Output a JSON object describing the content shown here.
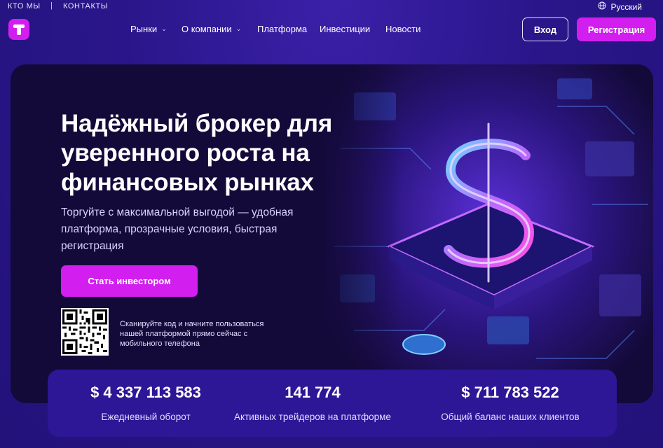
{
  "topbar": {
    "about": "КТО МЫ",
    "separator": "|",
    "contacts": "КОНТАКТЫ",
    "language": "Русский",
    "language_icon": "globe-icon"
  },
  "header": {
    "logo_icon": "t-logo-icon",
    "nav": [
      {
        "label": "Рынки",
        "dropdown": true
      },
      {
        "label": "О компании",
        "dropdown": true
      },
      {
        "label": "Платформа",
        "dropdown": false
      },
      {
        "label": "Инвестиции",
        "dropdown": false
      },
      {
        "label": "Новости",
        "dropdown": false
      }
    ],
    "login_label": "Вход",
    "register_label": "Регистрация"
  },
  "hero": {
    "title": "Надёжный брокер для уверенного роста на финансовых рынках",
    "subtitle": "Торгуйте с максимальной выгодой — удобная платформа, прозрачные условия, быстрая регистрация",
    "cta_label": "Стать инвестором",
    "qr_text": "Сканируйте код и начните пользоваться нашей платформой прямо сейчас с мобильного телефона",
    "art_icon": "neon-dollar-illustration"
  },
  "stats": [
    {
      "value": "$ 4 337 113 583",
      "label": "Ежедневный оборот"
    },
    {
      "value": "141 774",
      "label": "Активных трейдеров на платформе"
    },
    {
      "value": "$ 711 783 522",
      "label": "Общий баланс наших клиентов"
    }
  ],
  "colors": {
    "accent": "#d21ff0",
    "background": "#2a168a",
    "hero_bg": "#140a3a",
    "stats_bg": "#2d1796"
  }
}
